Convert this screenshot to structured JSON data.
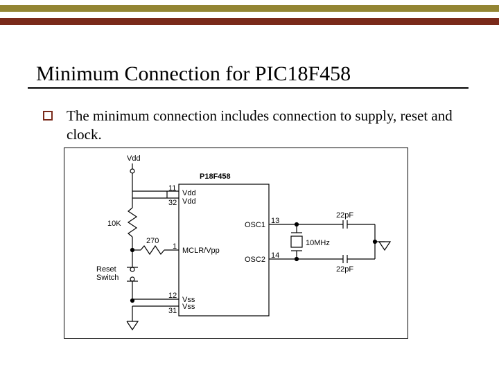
{
  "slide": {
    "title": "Minimum Connection for PIC18F458",
    "body": "The minimum connection includes  connection to supply, reset and clock."
  },
  "schematic": {
    "chip_label": "P18F458",
    "supply_label": "Vdd",
    "pins": {
      "vdd_top": "11",
      "vdd_bot": "32",
      "vdd_name": "Vdd",
      "mclr_num": "1",
      "mclr_name": "MCLR/Vpp",
      "vss_top": "12",
      "vss_bot": "31",
      "vss_name": "Vss",
      "osc1_num": "13",
      "osc1_name": "OSC1",
      "osc2_num": "14",
      "osc2_name": "OSC2"
    },
    "resistor_pullup": "10K",
    "resistor_series": "270",
    "reset_switch": "Reset\nSwitch",
    "crystal": "10MHz",
    "cap_top": "22pF",
    "cap_bot": "22pF"
  }
}
